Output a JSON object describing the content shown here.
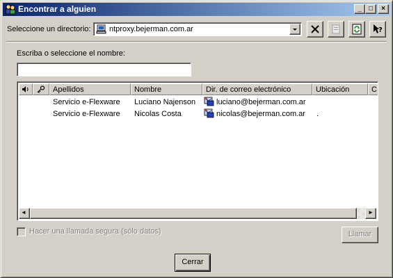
{
  "window": {
    "title": "Encontrar a alguien",
    "buttons": {
      "minimize": "_",
      "maximize": "□",
      "close": "×"
    }
  },
  "directory": {
    "label": "Seleccione un directorio:",
    "selected": "ntproxy.bejerman.com.ar",
    "tools": [
      "delete-icon",
      "properties-icon",
      "refresh-icon",
      "help-icon"
    ]
  },
  "search": {
    "label": "Escriba o seleccione el nombre:",
    "value": ""
  },
  "table": {
    "columns": [
      "Apellidos",
      "Nombre",
      "Dir. de correo electrónico",
      "Ubicación",
      "C"
    ],
    "rows": [
      {
        "apellidos": "Servicio e-Flexware",
        "nombre": "Luciano Najenson",
        "email": "luciano@bejerman.com.ar",
        "ubicacion": ""
      },
      {
        "apellidos": "Servicio e-Flexware",
        "nombre": "Nicolas Costa",
        "email": "nicolas@bejerman.com.ar",
        "ubicacion": "."
      }
    ],
    "scroll_left": "◄",
    "scroll_right": "►"
  },
  "secure_call": {
    "label": "Hacer una llamada segura (sólo datos)",
    "checked": false
  },
  "buttons": {
    "call": "Llamar",
    "close": "Cerrar"
  },
  "colors": {
    "face": "#d4d0c8",
    "titlebar_start": "#0a246a",
    "titlebar_end": "#a6caf0"
  }
}
